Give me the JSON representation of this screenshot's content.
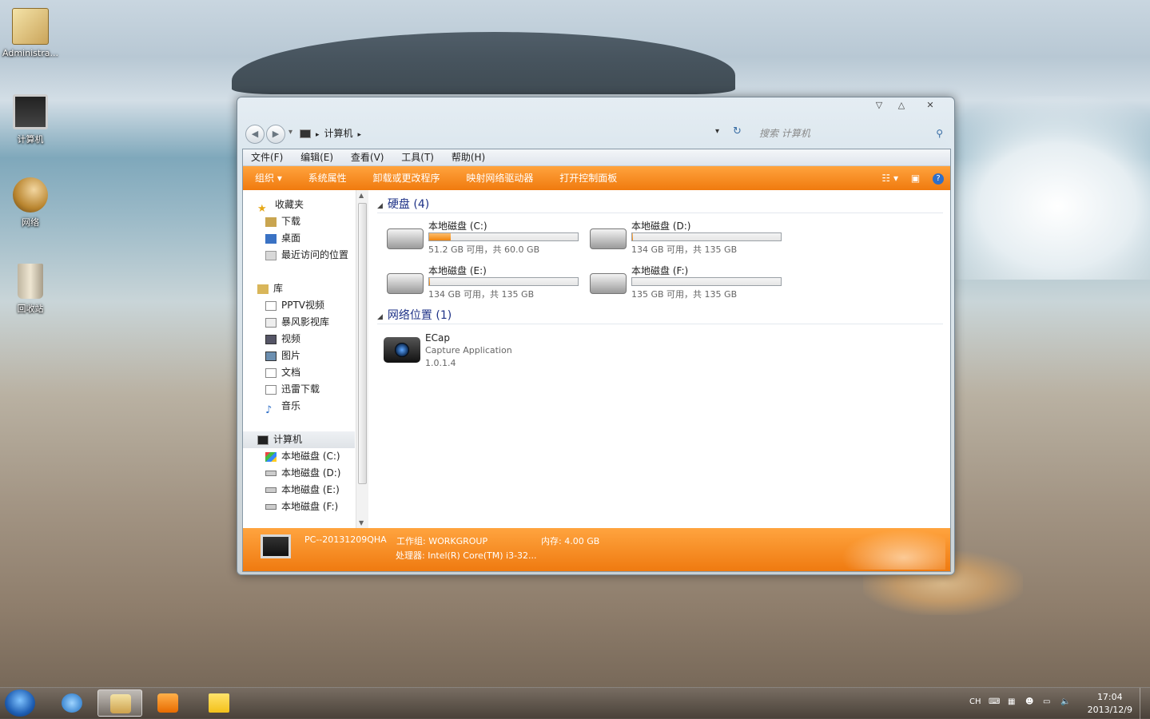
{
  "desktop": {
    "icons": [
      {
        "label": "Administra..."
      },
      {
        "label": "计算机"
      },
      {
        "label": "网络"
      },
      {
        "label": "回收站"
      }
    ]
  },
  "window": {
    "controls": {
      "minimize": "▽",
      "maximize": "△",
      "close": "✕"
    },
    "nav": {
      "back": "◀",
      "forward": "▶",
      "dropdown": "▾",
      "refresh": "↻"
    },
    "address": {
      "crumb": "计算机"
    },
    "search": {
      "placeholder": "搜索 计算机",
      "icon": "⚲"
    },
    "menu": [
      "文件(F)",
      "编辑(E)",
      "查看(V)",
      "工具(T)",
      "帮助(H)"
    ],
    "commands": [
      "组织 ▾",
      "系统属性",
      "卸载或更改程序",
      "映射网络驱动器",
      "打开控制面板"
    ],
    "cmd_right": {
      "views": "☷ ▾",
      "pane": "▣",
      "help": "?"
    },
    "sidebar": {
      "favorites": "收藏夹",
      "fav_items": [
        "下载",
        "桌面",
        "最近访问的位置"
      ],
      "libraries": "库",
      "lib_items": [
        "PPTV视频",
        "暴风影视库",
        "视频",
        "图片",
        "文档",
        "迅雷下载",
        "音乐"
      ],
      "computer": "计算机",
      "comp_items": [
        "本地磁盘 (C:)",
        "本地磁盘 (D:)",
        "本地磁盘 (E:)",
        "本地磁盘 (F:)"
      ]
    },
    "groups": {
      "hard_disks": "硬盘 (4)",
      "network": "网络位置 (1)"
    },
    "drives": [
      {
        "name": "本地磁盘 (C:)",
        "free": "51.2 GB 可用，共 60.0 GB",
        "used_fraction": 0.147
      },
      {
        "name": "本地磁盘 (D:)",
        "free": "134 GB 可用，共 135 GB",
        "used_fraction": 0.007
      },
      {
        "name": "本地磁盘 (E:)",
        "free": "134 GB 可用，共 135 GB",
        "used_fraction": 0.007
      },
      {
        "name": "本地磁盘 (F:)",
        "free": "135 GB 可用，共 135 GB",
        "used_fraction": 0.0
      }
    ],
    "network_item": {
      "name": "ECap",
      "type": "Capture Application",
      "version": "1.0.1.4"
    },
    "details": {
      "pc_name": "PC--20131209QHA",
      "workgroup": "工作组: WORKGROUP",
      "memory": "内存: 4.00 GB",
      "cpu": "处理器: Intel(R) Core(TM) i3-32..."
    }
  },
  "taskbar": {
    "tray": {
      "lang": "CH"
    },
    "clock": {
      "time": "17:04",
      "date": "2013/12/9"
    }
  },
  "colors": {
    "accent": "#f07a0e",
    "group_header": "#1e3287"
  }
}
